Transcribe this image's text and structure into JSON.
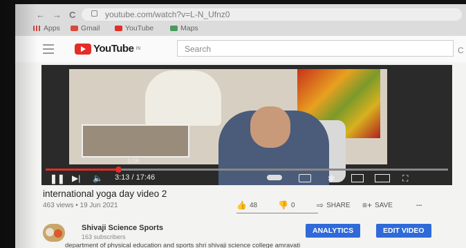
{
  "browser": {
    "nav": {
      "back": "←",
      "forward": "→",
      "reload": "C"
    },
    "url": "youtube.com/watch?v=L-N_Ufnz0",
    "bookmarks": [
      "Apps",
      "Gmail",
      "YouTube",
      "Maps"
    ]
  },
  "yt": {
    "logo_text": "YouTube",
    "logo_sup": "IN",
    "search_placeholder": "Search",
    "search_right_char": "C"
  },
  "player": {
    "preview_time": "3:06",
    "time_display": "3:13 / 17:46",
    "progress_fraction": 0.18,
    "controls": [
      "pause-icon",
      "next-icon",
      "volume-icon",
      "autoplay-toggle",
      "subtitles-icon",
      "settings-icon",
      "miniplayer-icon",
      "theater-icon",
      "fullscreen-icon"
    ]
  },
  "video": {
    "title": "international yoga day video 2",
    "views_date": "463 views • 19 Jun 2021",
    "likes": "48",
    "dislikes": "0",
    "share_label": "SHARE",
    "save_label": "SAVE",
    "more_label": "..."
  },
  "channel": {
    "name": "Shivaji Science Sports",
    "subscribers": "163 subscribers",
    "analytics_label": "ANALYTICS",
    "edit_label": "EDIT VIDEO",
    "description": "department of physical education and sports shri shivaji science college amravati"
  },
  "colors": {
    "accent": "#e52d27",
    "button_blue": "#2f6ad8"
  }
}
